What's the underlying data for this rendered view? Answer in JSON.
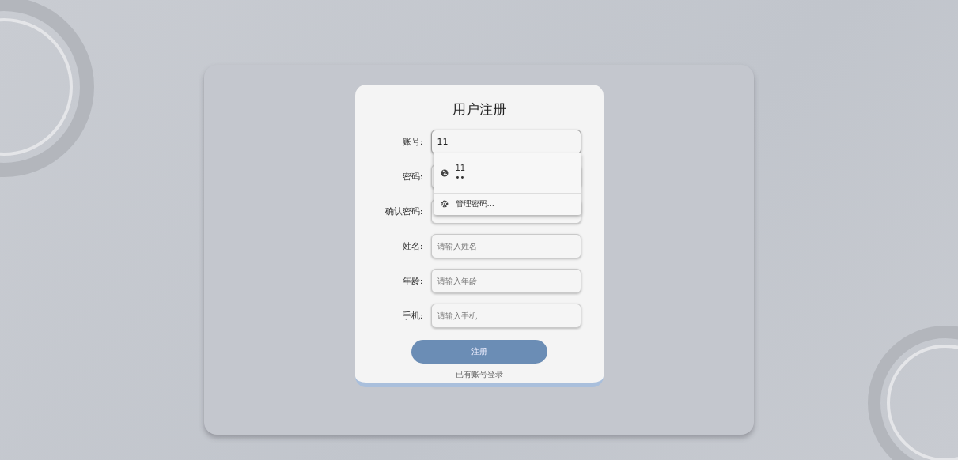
{
  "title": "用户注册",
  "fields": [
    {
      "label": "账号:",
      "value": "11",
      "focused": true
    },
    {
      "label": "密码:"
    },
    {
      "label": "确认密码:"
    },
    {
      "label": "姓名:",
      "placeholder": "请输入姓名"
    },
    {
      "label": "年龄:",
      "placeholder": "请输入年龄"
    },
    {
      "label": "手机:",
      "placeholder": "请输入手机"
    }
  ],
  "autofill": {
    "username": "11",
    "password": "••",
    "manage": "管理密码..."
  },
  "submit": "注册",
  "login_link": "已有账号登录"
}
